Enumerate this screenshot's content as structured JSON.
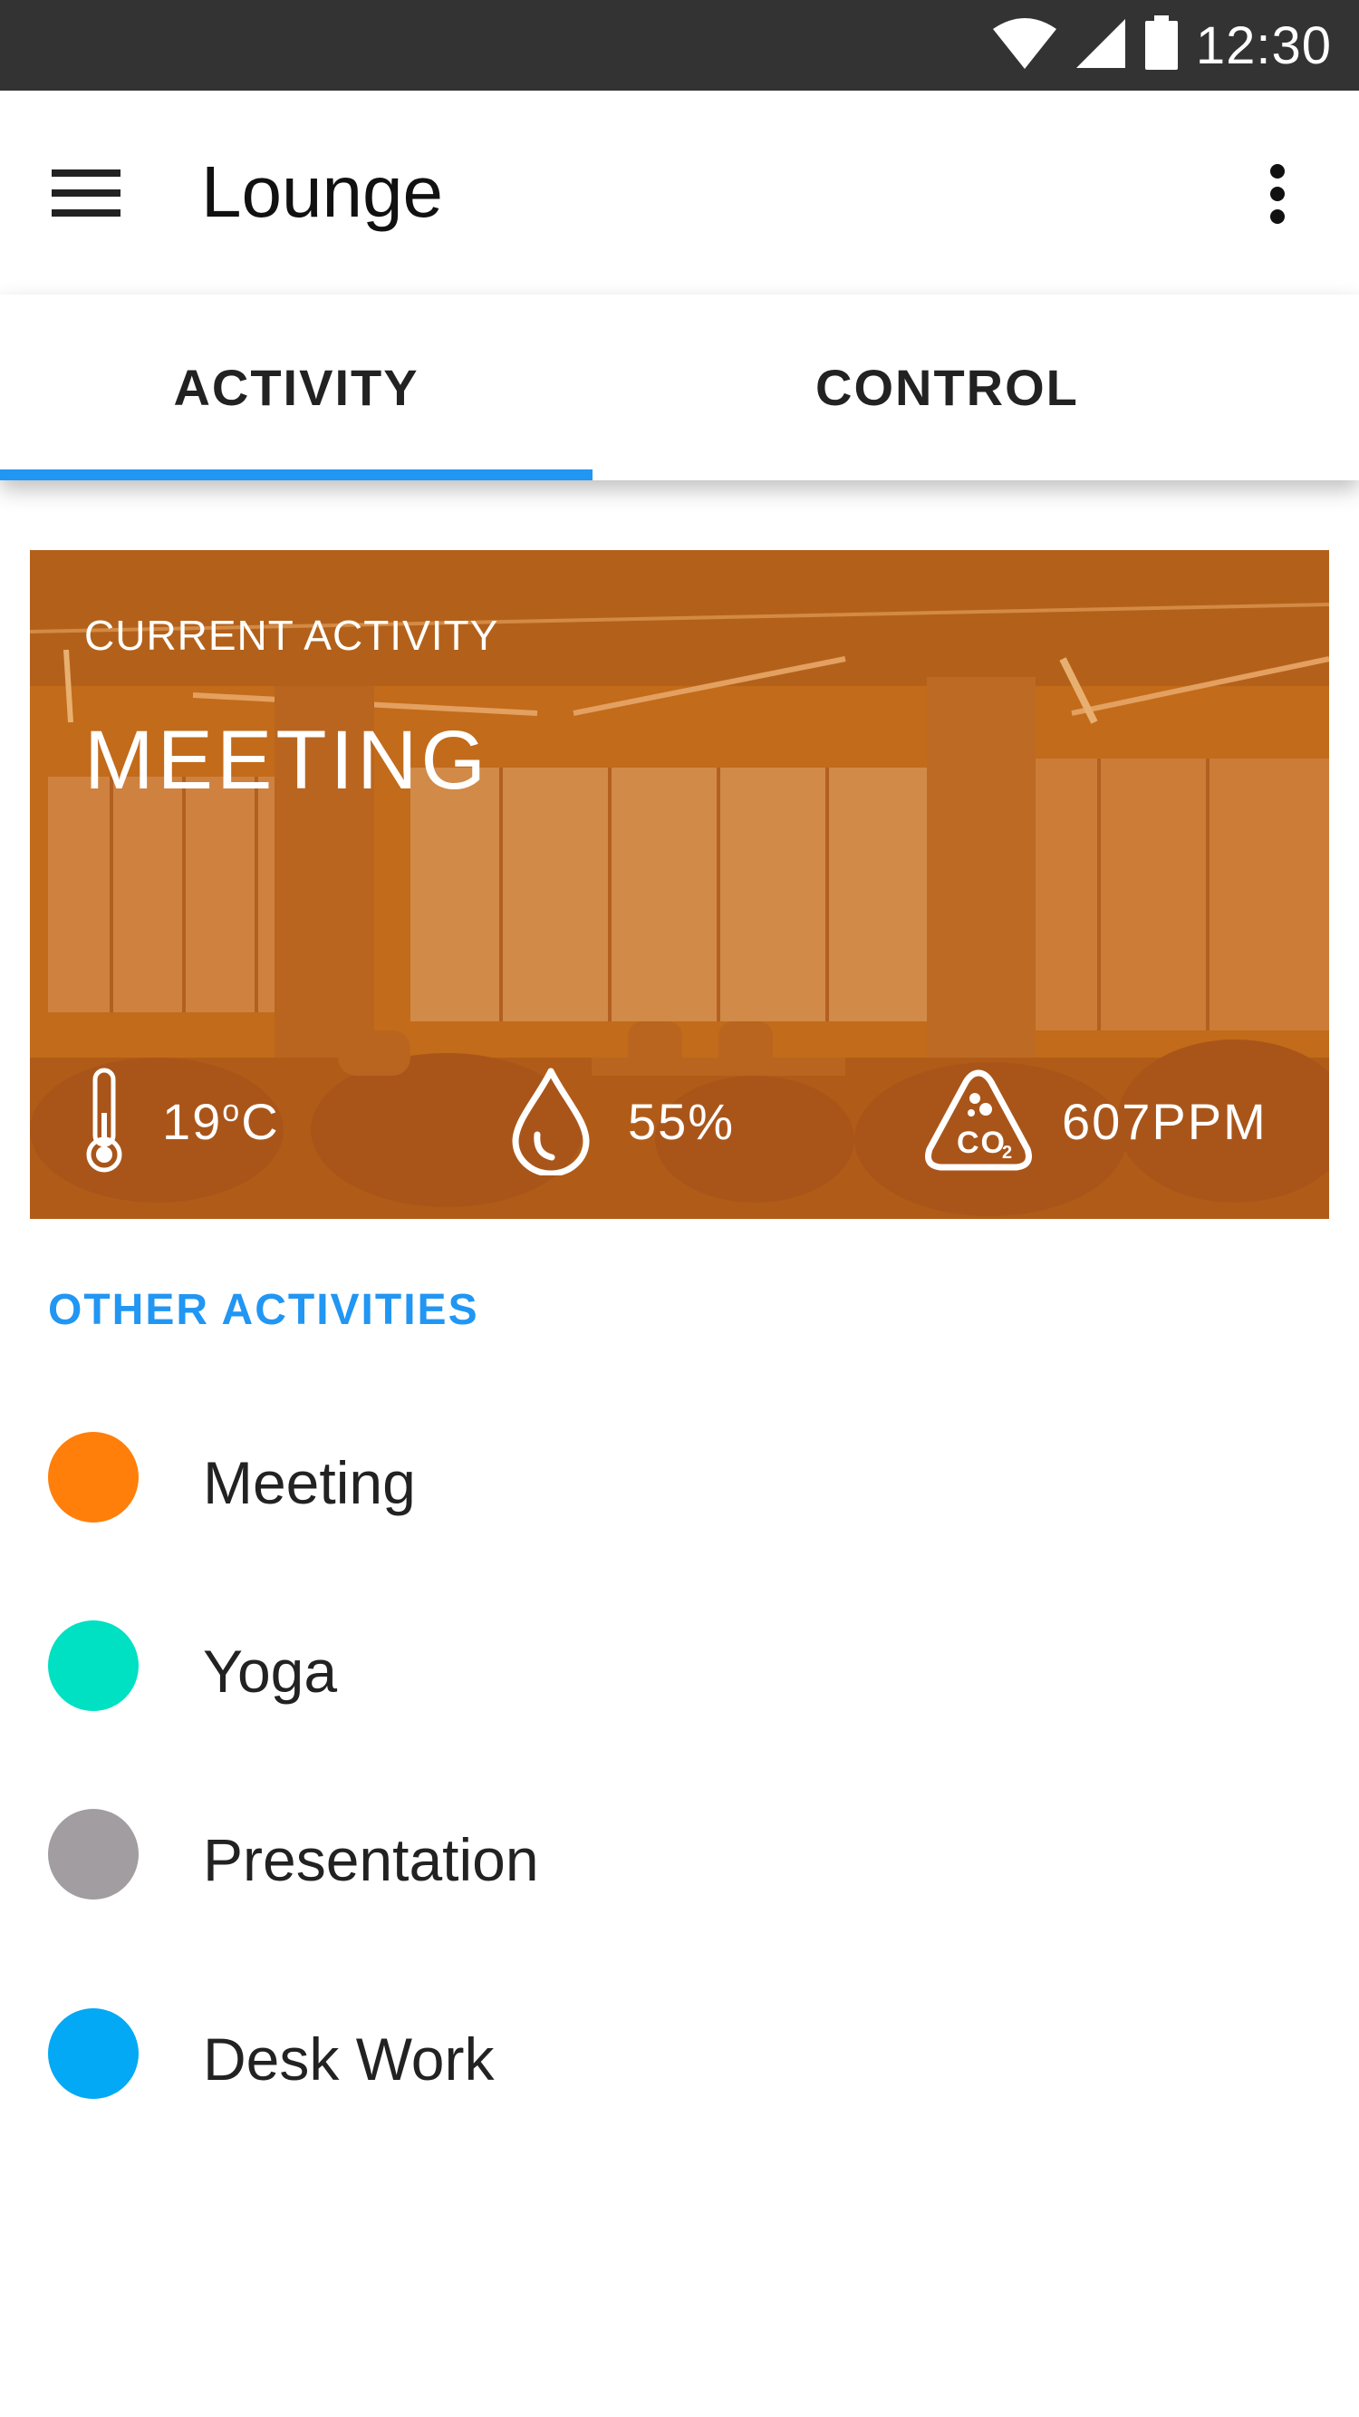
{
  "status_bar": {
    "time": "12:30",
    "icons": [
      "wifi-icon",
      "cellular-signal-icon",
      "battery-icon"
    ]
  },
  "app_bar": {
    "title": "Lounge",
    "menu_icon": "hamburger-menu-icon",
    "more_icon": "more-vert-icon"
  },
  "tabs": [
    {
      "label": "ACTIVITY",
      "selected": true
    },
    {
      "label": "CONTROL",
      "selected": false
    }
  ],
  "accent_color": "#2196f3",
  "current_activity": {
    "overline": "CURRENT ACTIVITY",
    "title": "MEETING",
    "card_color": "#c26b1a",
    "metrics": {
      "temperature": {
        "value": "19",
        "unit_sup": "o",
        "unit": "C",
        "icon": "thermometer-icon"
      },
      "humidity": {
        "value": "55%",
        "icon": "water-drop-icon"
      },
      "co2": {
        "value": "607PPM",
        "icon": "co2-icon"
      }
    }
  },
  "other_activities": {
    "header": "OTHER ACTIVITIES",
    "items": [
      {
        "label": "Meeting",
        "color": "#ff7f0a"
      },
      {
        "label": "Yoga",
        "color": "#00e0c3"
      },
      {
        "label": "Presentation",
        "color": "#a19da1"
      },
      {
        "label": "Desk Work",
        "color": "#03a9f4"
      }
    ]
  }
}
